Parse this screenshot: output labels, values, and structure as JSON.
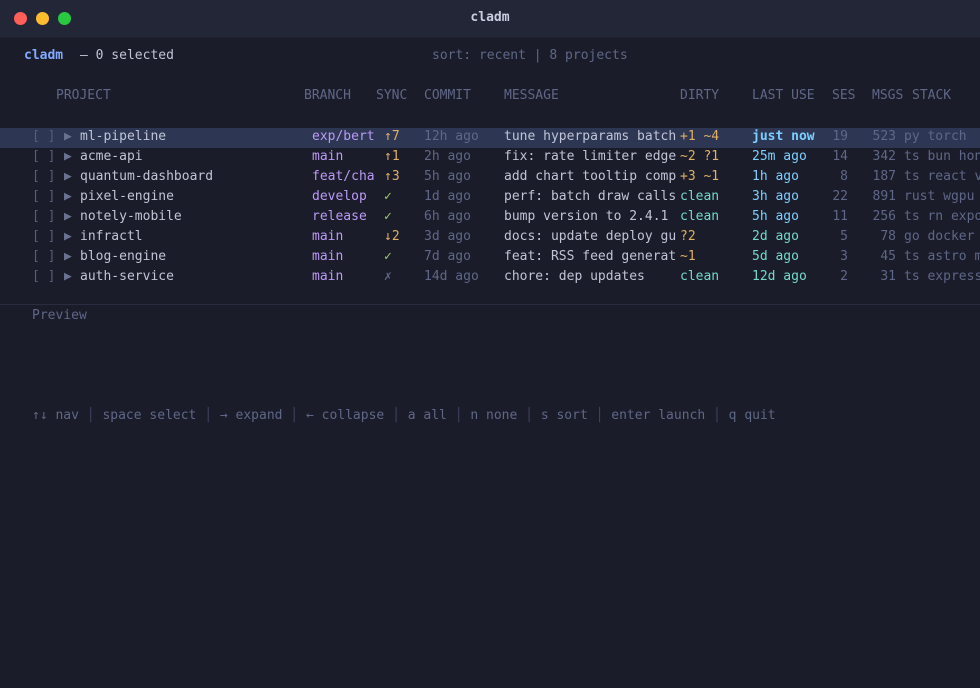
{
  "window": {
    "title": "cladm"
  },
  "app": {
    "name": "cladm",
    "selected_label": "— 0 selected"
  },
  "sort_info": "sort: recent | 8 projects",
  "columns": {
    "project": "PROJECT",
    "branch": "BRANCH",
    "sync": "SYNC",
    "commit": "COMMIT",
    "message": "MESSAGE",
    "dirty": "DIRTY",
    "last_use": "LAST USE",
    "ses": "SES",
    "msgs": "MSGS",
    "stack": "STACK"
  },
  "rows": [
    {
      "check": "[ ]",
      "arrow": "▶",
      "name": "ml-pipeline",
      "branch": "exp/bert",
      "sync": "↑7",
      "sync_kind": "up",
      "commit": "12h ago",
      "message": "tune hyperparams batch",
      "dirty": "+1 ~4",
      "dirty_kind": "changed",
      "last_use": "just now",
      "last_kind": "now",
      "ses": "19",
      "msgs": "523",
      "stack": "py torch"
    },
    {
      "check": "[ ]",
      "arrow": "▶",
      "name": "acme-api",
      "branch": "main",
      "sync": "↑1",
      "sync_kind": "up",
      "commit": "2h ago",
      "message": "fix: rate limiter edge",
      "dirty": "~2 ?1",
      "dirty_kind": "changed",
      "last_use": "25m ago",
      "last_kind": "recent",
      "ses": "14",
      "msgs": "342",
      "stack": "ts bun hono"
    },
    {
      "check": "[ ]",
      "arrow": "▶",
      "name": "quantum-dashboard",
      "branch": "feat/cha",
      "sync": "↑3",
      "sync_kind": "up",
      "commit": "5h ago",
      "message": "add chart tooltip comp",
      "dirty": "+3 ~1",
      "dirty_kind": "changed",
      "last_use": "1h ago",
      "last_kind": "recent",
      "ses": "8",
      "msgs": "187",
      "stack": "ts react vite"
    },
    {
      "check": "[ ]",
      "arrow": "▶",
      "name": "pixel-engine",
      "branch": "develop",
      "sync": "✓",
      "sync_kind": "ok",
      "commit": "1d ago",
      "message": "perf: batch draw calls",
      "dirty": "clean",
      "dirty_kind": "clean",
      "last_use": "3h ago",
      "last_kind": "recent",
      "ses": "22",
      "msgs": "891",
      "stack": "rust wgpu"
    },
    {
      "check": "[ ]",
      "arrow": "▶",
      "name": "notely-mobile",
      "branch": "release",
      "sync": "✓",
      "sync_kind": "ok",
      "commit": "6h ago",
      "message": "bump version to 2.4.1",
      "dirty": "clean",
      "dirty_kind": "clean",
      "last_use": "5h ago",
      "last_kind": "recent",
      "ses": "11",
      "msgs": "256",
      "stack": "ts rn expo"
    },
    {
      "check": "[ ]",
      "arrow": "▶",
      "name": "infractl",
      "branch": "main",
      "sync": "↓2",
      "sync_kind": "down",
      "commit": "3d ago",
      "message": "docs: update deploy gu",
      "dirty": "?2",
      "dirty_kind": "changed",
      "last_use": "2d ago",
      "last_kind": "old",
      "ses": "5",
      "msgs": "78",
      "stack": "go docker"
    },
    {
      "check": "[ ]",
      "arrow": "▶",
      "name": "blog-engine",
      "branch": "main",
      "sync": "✓",
      "sync_kind": "ok",
      "commit": "7d ago",
      "message": "feat: RSS feed generat",
      "dirty": "~1",
      "dirty_kind": "changed",
      "last_use": "5d ago",
      "last_kind": "old",
      "ses": "3",
      "msgs": "45",
      "stack": "ts astro mdx"
    },
    {
      "check": "[ ]",
      "arrow": "▶",
      "name": "auth-service",
      "branch": "main",
      "sync": "✗",
      "sync_kind": "x",
      "commit": "14d ago",
      "message": "chore: dep updates",
      "dirty": "clean",
      "dirty_kind": "clean",
      "last_use": "12d ago",
      "last_kind": "old",
      "ses": "2",
      "msgs": "31",
      "stack": "ts express"
    }
  ],
  "selected_row": 0,
  "preview_label": "Preview",
  "keybinds": [
    "↑↓ nav",
    "space select",
    "→ expand",
    "← collapse",
    "a all",
    "n none",
    "s sort",
    "enter launch",
    "q quit"
  ],
  "colors": {
    "background": "#1b1c29",
    "titlebar": "#232637",
    "accent": "#82aaff",
    "branch": "#bb9af7",
    "warn": "#e0af68",
    "ok": "#9ece6a",
    "clean": "#73daca",
    "muted": "#5f6788",
    "selection": "#2d3754"
  }
}
